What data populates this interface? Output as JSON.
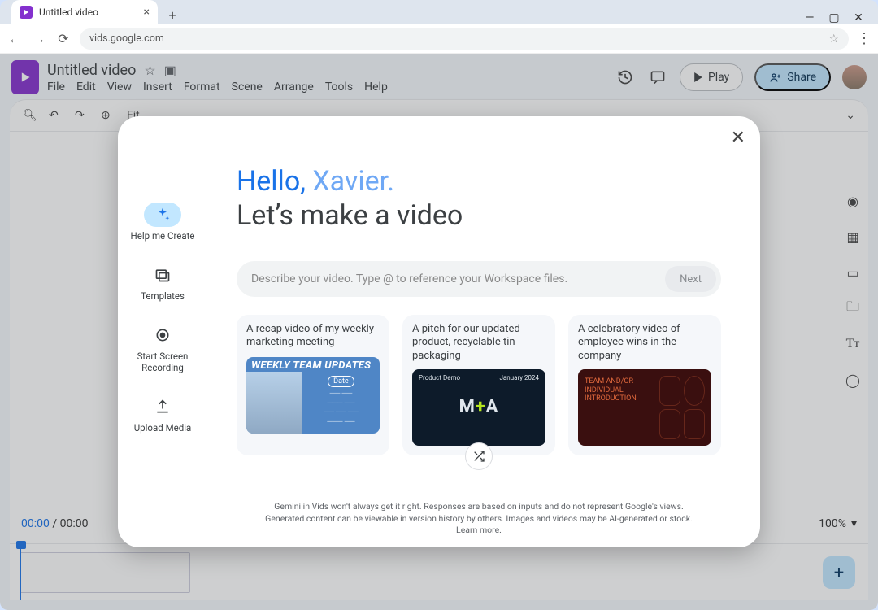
{
  "browser": {
    "tab_title": "Untitled video",
    "url": "vids.google.com"
  },
  "window_controls": {
    "minimize": "—",
    "maximize": "▢",
    "close": "✕"
  },
  "app": {
    "doc_title": "Untitled video",
    "menus": [
      "File",
      "Edit",
      "View",
      "Insert",
      "Format",
      "Scene",
      "Arrange",
      "Tools",
      "Help"
    ],
    "play_label": "Play",
    "share_label": "Share",
    "fit_label": "Fit",
    "time_current": "00:00",
    "time_total": "00:00",
    "zoom_label": "100%"
  },
  "dialog": {
    "greeting_prefix": "Hello, ",
    "greeting_name": "Xavier",
    "greeting_suffix": ".",
    "subheadline": "Let’s make a video",
    "prompt_placeholder": "Describe your video. Type @ to reference your Workspace files.",
    "next_label": "Next",
    "side": [
      {
        "label": "Help me Create"
      },
      {
        "label": "Templates"
      },
      {
        "label": "Start Screen Recording"
      },
      {
        "label": "Upload Media"
      }
    ],
    "cards": [
      {
        "caption": "A recap video of my weekly marketing meeting",
        "thumb": {
          "headline": "WEEKLY TEAM UPDATES",
          "pill": "Date"
        }
      },
      {
        "caption": "A pitch for our updated product, recyclable tin packaging",
        "thumb": {
          "left": "Product Demo",
          "right": "January 2024",
          "center": "M+A"
        }
      },
      {
        "caption": "A celebratory video of employee wins in the company",
        "thumb": {
          "line1": "TEAM AND/OR",
          "line2": "INDIVIDUAL",
          "line3": "INTRODUCTION"
        }
      }
    ],
    "disclaimer": "Gemini in Vids won't always get it right. Responses are based on inputs and do not represent Google's views. Generated content can be viewable in version history by others. Images and videos may be AI-generated or stock. ",
    "learn_more": "Learn more."
  }
}
